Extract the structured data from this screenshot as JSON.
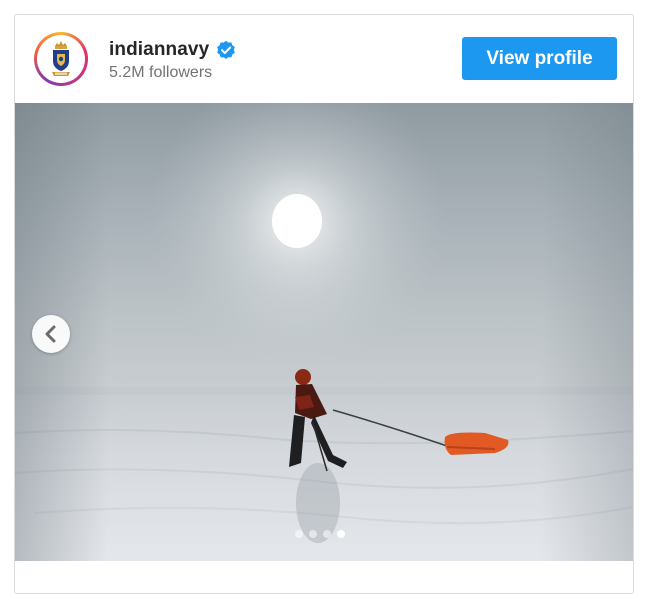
{
  "profile": {
    "username": "indiannavy",
    "verified": true,
    "followers": "5.2M followers",
    "avatar_icon": "indian-navy-crest-icon"
  },
  "actions": {
    "view_profile_label": "View profile"
  },
  "colors": {
    "button_blue": "#1d98f0",
    "verified_blue": "#1d98f0",
    "username": "#262626",
    "muted_text": "#737373"
  },
  "media": {
    "carousel": {
      "total": 4,
      "current": 4,
      "prev_icon": "chevron-left-icon"
    }
  }
}
